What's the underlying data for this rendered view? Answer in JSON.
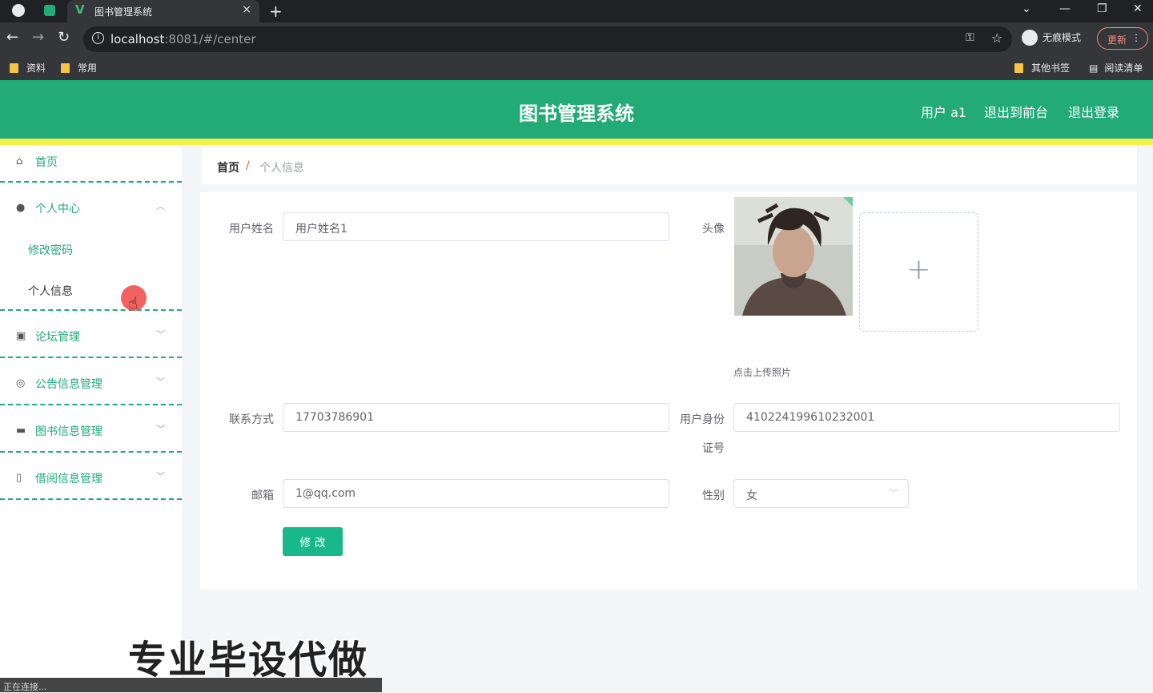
{
  "browser": {
    "tab_title": "图书管理系统",
    "tab_close": "×",
    "new_tab": "+",
    "url_host": "localhost",
    "url_rest": ":8081/#/center",
    "incognito_label": "无痕模式",
    "update_label": "更新",
    "bookmarks_left": [
      "资料",
      "常用"
    ],
    "bookmarks_right": [
      "其他书签",
      "阅读清单"
    ]
  },
  "header": {
    "title": "图书管理系统",
    "user": "用户 a1",
    "back_front": "退出到前台",
    "logout": "退出登录"
  },
  "sidebar": {
    "home": "首页",
    "personal_center": "个人中心",
    "change_password": "修改密码",
    "personal_info": "个人信息",
    "forum": "论坛管理",
    "notice": "公告信息管理",
    "books": "图书信息管理",
    "borrow": "借阅信息管理"
  },
  "breadcrumb": {
    "home": "首页",
    "separator": "/",
    "current": "个人信息"
  },
  "form": {
    "name_label": "用户姓名",
    "name_value": "用户姓名1",
    "avatar_label": "头像",
    "upload_hint": "点击上传照片",
    "phone_label": "联系方式",
    "phone_value": "17703786901",
    "id_label_line1": "用户身份",
    "id_label_line2": "证号",
    "id_value": "410224199610232001",
    "email_label": "邮箱",
    "email_value": "1@qq.com",
    "gender_label": "性别",
    "gender_value": "女",
    "submit": "修 改"
  },
  "watermark": "专业毕设代做",
  "status": "正在连接..."
}
